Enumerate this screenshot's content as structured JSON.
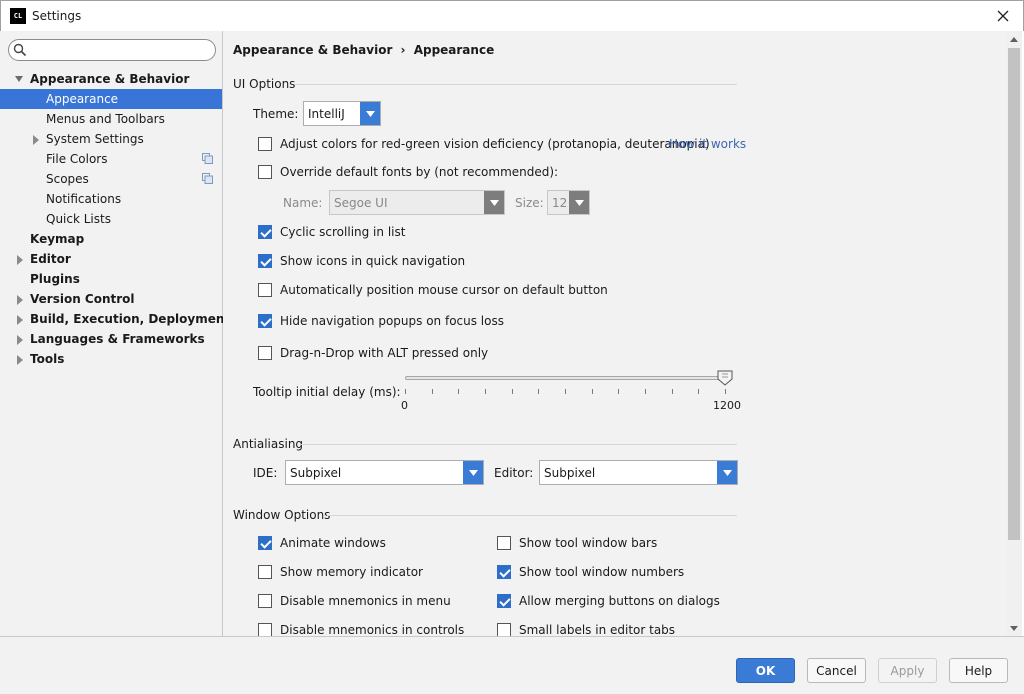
{
  "window": {
    "title": "Settings",
    "app_icon_text": "CL"
  },
  "search": {
    "value": "",
    "placeholder": ""
  },
  "tree": {
    "appearance_behavior": "Appearance & Behavior",
    "appearance": "Appearance",
    "menus_toolbars": "Menus and Toolbars",
    "system_settings": "System Settings",
    "file_colors": "File Colors",
    "scopes": "Scopes",
    "notifications": "Notifications",
    "quick_lists": "Quick Lists",
    "keymap": "Keymap",
    "editor": "Editor",
    "plugins": "Plugins",
    "version_control": "Version Control",
    "build": "Build, Execution, Deployment",
    "languages": "Languages & Frameworks",
    "tools": "Tools"
  },
  "breadcrumb": {
    "parent": "Appearance & Behavior",
    "separator": "›",
    "current": "Appearance"
  },
  "ui_options": {
    "title": "UI Options",
    "theme_label": "Theme:",
    "theme_value": "IntelliJ",
    "adjust_colors": "Adjust colors for red-green vision deficiency (protanopia, deuteranopia)",
    "how_it_works": "How it works",
    "override_fonts": "Override default fonts by (not recommended):",
    "name_label": "Name:",
    "name_value": "Segoe UI",
    "size_label": "Size:",
    "size_value": "12",
    "cyclic_scrolling": "Cyclic scrolling in list",
    "show_icons": "Show icons in quick navigation",
    "auto_position": "Automatically position mouse cursor on default button",
    "hide_nav_popups": "Hide navigation popups on focus loss",
    "drag_drop_alt": "Drag-n-Drop with ALT pressed only",
    "tooltip_label": "Tooltip initial delay (ms):",
    "slider_min": "0",
    "slider_max": "1200",
    "slider_value": 1200
  },
  "checks": {
    "adjust_colors": false,
    "override_fonts": false,
    "cyclic_scrolling": true,
    "show_icons": true,
    "auto_position": false,
    "hide_nav_popups": true,
    "drag_drop_alt": false,
    "animate_windows": true,
    "show_memory": false,
    "disable_mnemonics_menu": false,
    "disable_mnemonics_controls": false,
    "show_tool_bars": false,
    "show_tool_numbers": true,
    "allow_merging": true,
    "small_labels": false
  },
  "antialiasing": {
    "title": "Antialiasing",
    "ide_label": "IDE:",
    "ide_value": "Subpixel",
    "editor_label": "Editor:",
    "editor_value": "Subpixel"
  },
  "window_options": {
    "title": "Window Options",
    "animate_windows": "Animate windows",
    "show_memory": "Show memory indicator",
    "disable_mnemonics_menu": "Disable mnemonics in menu",
    "disable_mnemonics_controls": "Disable mnemonics in controls",
    "show_tool_bars": "Show tool window bars",
    "show_tool_numbers": "Show tool window numbers",
    "allow_merging": "Allow merging buttons on dialogs",
    "small_labels": "Small labels in editor tabs"
  },
  "buttons": {
    "ok": "OK",
    "cancel": "Cancel",
    "apply": "Apply",
    "help": "Help"
  },
  "colors": {
    "accent": "#3a7bd5",
    "selection": "#3875d7",
    "panel": "#f2f2f2",
    "link": "#3d66b0"
  }
}
